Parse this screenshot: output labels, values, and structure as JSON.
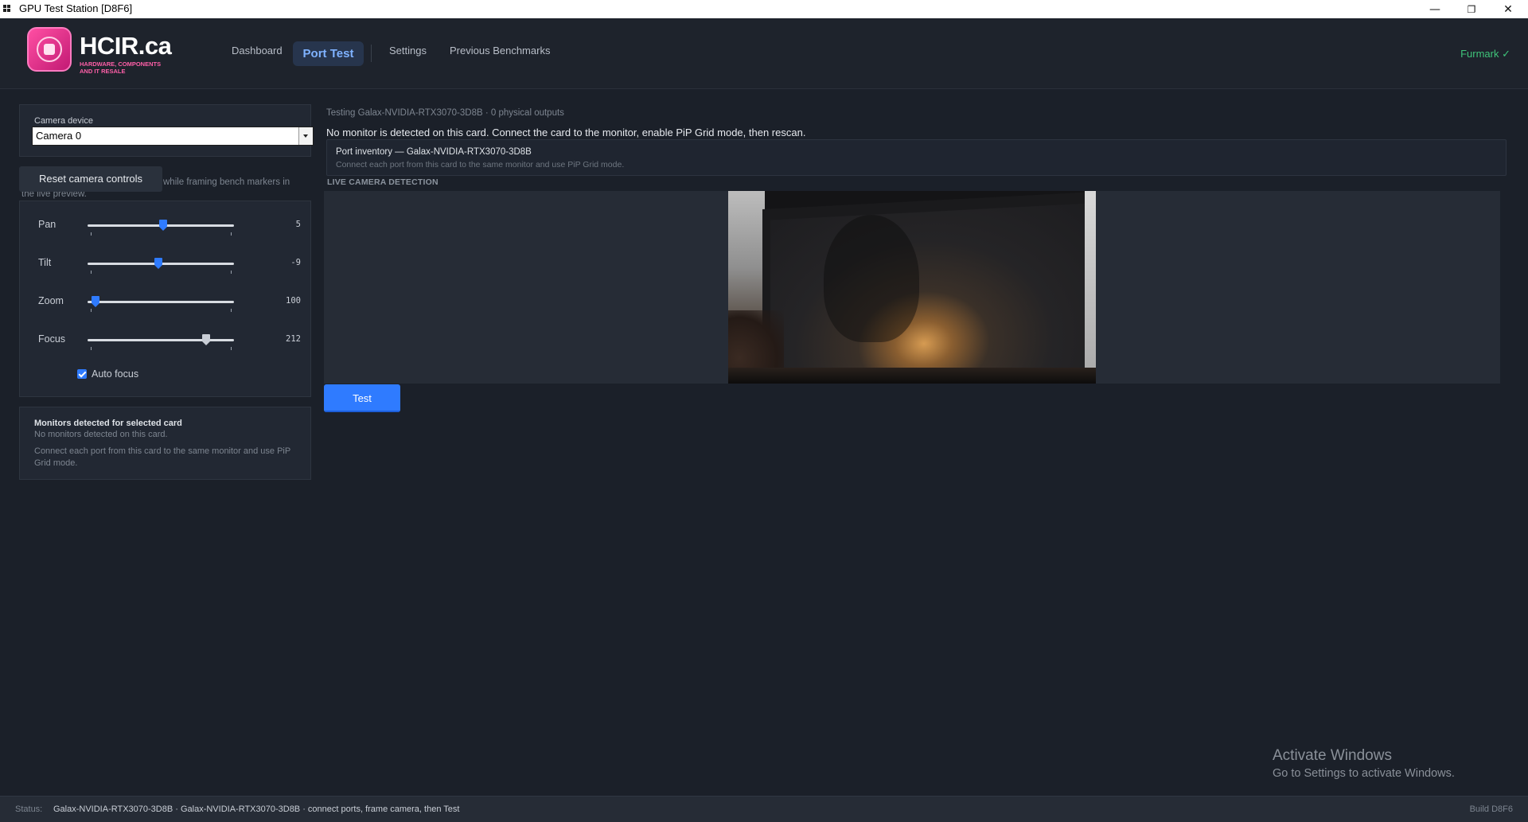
{
  "window": {
    "title": "GPU Test Station  [D8F6]",
    "minimize_glyph": "—",
    "maximize_glyph": "❐",
    "close_glyph": "✕"
  },
  "header": {
    "logo_text": "HCIR.ca",
    "logo_sub": "HARDWARE, COMPONENTS AND IT RESALE",
    "nav": [
      {
        "label": "Dashboard"
      },
      {
        "label": "Port Test"
      },
      {
        "label": "Settings"
      },
      {
        "label": "Previous Benchmarks"
      }
    ],
    "active_nav": "Port Test",
    "furmark": "Furmark ✓"
  },
  "camera": {
    "device_label": "Camera device",
    "device_value": "Camera 0",
    "reset_label": "Reset camera controls",
    "hint": "while framing bench markers in the live preview.",
    "sliders": [
      {
        "label": "Pan",
        "value": "5",
        "fraction": 0.52,
        "color": "#2f7bff"
      },
      {
        "label": "Tilt",
        "value": "-9",
        "fraction": 0.48,
        "color": "#2f7bff"
      },
      {
        "label": "Zoom",
        "value": "100",
        "fraction": 0.03,
        "color": "#2f7bff"
      },
      {
        "label": "Focus",
        "value": "212",
        "fraction": 0.83,
        "color": "#c9ced6"
      }
    ],
    "auto_focus_label": "Auto focus",
    "auto_focus_checked": true
  },
  "monitors": {
    "title": "Monitors detected for selected card",
    "none": "No monitors detected on this card.",
    "hint": "Connect each port from this card to the same monitor and use PiP Grid mode."
  },
  "main": {
    "testing_line": "Testing Galax-NVIDIA-RTX3070-3D8B · 0 physical outputs",
    "warning": "No monitor is detected on this card. Connect the card to the monitor, enable PiP Grid mode, then rescan.",
    "inventory_title": "Port inventory — Galax-NVIDIA-RTX3070-3D8B",
    "inventory_hint": "Connect each port from this card to the same monitor and use PiP Grid mode.",
    "live_label": "LIVE CAMERA DETECTION",
    "test_button": "Test"
  },
  "watermark": {
    "line1": "Activate Windows",
    "line2": "Go to Settings to activate Windows."
  },
  "status": {
    "label": "Status:",
    "value": "Galax-NVIDIA-RTX3070-3D8B · Galax-NVIDIA-RTX3070-3D8B · connect ports, frame camera, then Test",
    "build": "Build D8F6"
  },
  "colors": {
    "accent": "#2f7bff",
    "success": "#3fc47a",
    "brand": "#ff4fa3"
  }
}
